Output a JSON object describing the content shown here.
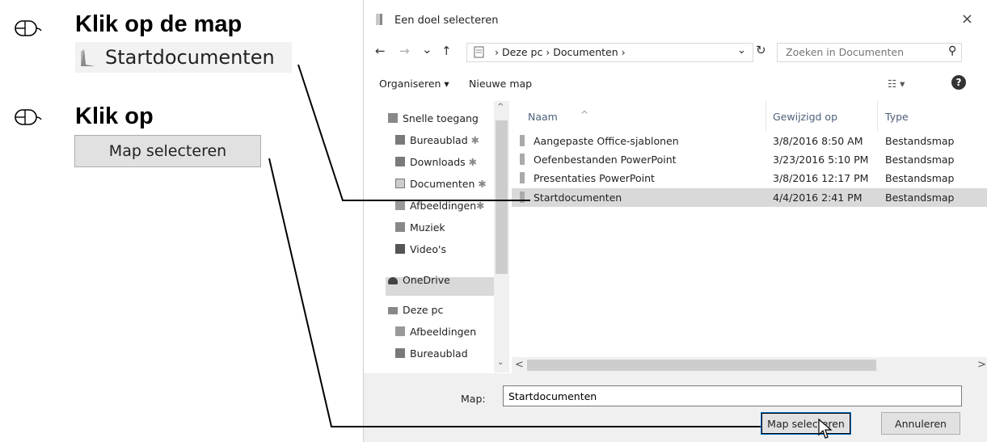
{
  "instructions": {
    "step1_title": "Klik op de map",
    "step1_chip_label": "Startdocumenten",
    "step2_title": "Klik op",
    "step2_button_label": "Map selecteren"
  },
  "dialog": {
    "title": "Een doel selecteren",
    "close_glyph": "×",
    "nav": {
      "back": "←",
      "forward": "→",
      "recent": "⌄",
      "up": "↑"
    },
    "breadcrumb": "›  Deze pc  ›  Documenten  ›",
    "address_dropdown": "⌄",
    "refresh_glyph": "↻",
    "search_placeholder": "Zoeken in Documenten",
    "search_glyph": "⚲",
    "toolbar": {
      "organize": "Organiseren ▾",
      "new_folder": "Nieuwe map",
      "view": "☷ ▾",
      "help": "?"
    },
    "navpane": [
      {
        "label": "Snelle toegang",
        "pinned": false,
        "icon": "star-icon"
      },
      {
        "label": "Bureaublad",
        "pinned": true,
        "icon": "desktop-icon"
      },
      {
        "label": "Downloads",
        "pinned": true,
        "icon": "download-icon"
      },
      {
        "label": "Documenten",
        "pinned": true,
        "icon": "document-icon"
      },
      {
        "label": "Afbeeldingen",
        "pinned": true,
        "icon": "pictures-icon"
      },
      {
        "label": "Muziek",
        "pinned": false,
        "icon": "music-icon"
      },
      {
        "label": "Video's",
        "pinned": false,
        "icon": "video-icon"
      },
      {
        "label": "OneDrive",
        "pinned": false,
        "icon": "cloud-icon"
      },
      {
        "label": "Deze pc",
        "pinned": false,
        "icon": "computer-icon"
      },
      {
        "label": "Afbeeldingen",
        "pinned": false,
        "icon": "pictures-icon"
      },
      {
        "label": "Bureaublad",
        "pinned": false,
        "icon": "desktop-icon"
      }
    ],
    "pin_glyph": "✱",
    "columns": {
      "name": "Naam",
      "date": "Gewijzigd op",
      "type": "Type",
      "sort_caret": "^"
    },
    "files": [
      {
        "name": "Aangepaste Office-sjablonen",
        "date": "3/8/2016 8:50 AM",
        "type": "Bestandsmap"
      },
      {
        "name": "Oefenbestanden PowerPoint",
        "date": "3/23/2016 5:10 PM",
        "type": "Bestandsmap"
      },
      {
        "name": "Presentaties PowerPoint",
        "date": "3/8/2016 12:17 PM",
        "type": "Bestandsmap"
      },
      {
        "name": "Startdocumenten",
        "date": "4/4/2016 2:41 PM",
        "type": "Bestandsmap",
        "selected": true
      }
    ],
    "scroll": {
      "up": "^",
      "down": "⌄",
      "left": "<",
      "right": ">"
    },
    "folder_label": "Map:",
    "folder_value": "Startdocumenten",
    "select_button": "Map selecteren",
    "cancel_button": "Annuleren"
  },
  "colors": {
    "selection": "#d9d9d9",
    "bottom_bar": "#f0f0f0",
    "header_text": "#4c607a"
  }
}
